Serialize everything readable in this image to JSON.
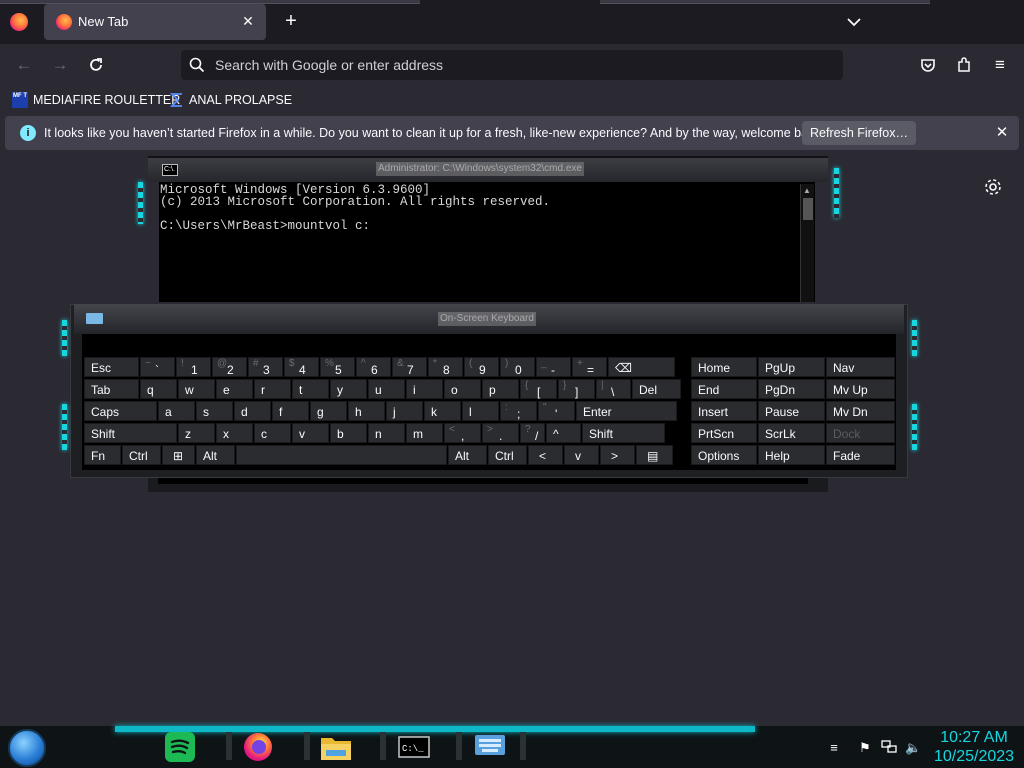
{
  "browser": {
    "tab_title": "New Tab",
    "url_placeholder": "Search with Google or enter address",
    "bookmarks": [
      {
        "label": "MEDIAFIRE ROULETTER",
        "icon_text": "MF T"
      },
      {
        "label": "ANAL PROLAPSE"
      }
    ],
    "notification": {
      "text": "It looks like you haven’t started Firefox in a while. Do you want to clean it up for a fresh, like-new experience? And by the way, welcome back!",
      "button": "Refresh Firefox…",
      "info_glyph": "i"
    },
    "accent_colors": {
      "chrome_bg": "#2b2a33",
      "tabstrip_bg": "#1c1b22",
      "notif_bg": "#42414d"
    }
  },
  "cmd": {
    "title": "Administrator: C:\\Windows\\system32\\cmd.exe",
    "icon_text": "C:\\.",
    "lines": [
      "Microsoft Windows [Version 6.3.9600]",
      "(c) 2013 Microsoft Corporation. All rights reserved.",
      "",
      "C:\\Users\\MrBeast>mountvol c:"
    ]
  },
  "osk": {
    "title": "On-Screen Keyboard",
    "rows": [
      [
        {
          "l": "Esc",
          "w": 56
        },
        {
          "s": "~",
          "m": "`",
          "w": 36
        },
        {
          "s": "!",
          "m": "1",
          "w": 36
        },
        {
          "s": "@",
          "m": "2",
          "w": 36
        },
        {
          "s": "#",
          "m": "3",
          "w": 36
        },
        {
          "s": "$",
          "m": "4",
          "w": 36
        },
        {
          "s": "%",
          "m": "5",
          "w": 36
        },
        {
          "s": "^",
          "m": "6",
          "w": 36
        },
        {
          "s": "&",
          "m": "7",
          "w": 36
        },
        {
          "s": "*",
          "m": "8",
          "w": 36
        },
        {
          "s": "(",
          "m": "9",
          "w": 36
        },
        {
          "s": ")",
          "m": "0",
          "w": 36
        },
        {
          "s": "_",
          "m": "-",
          "w": 36
        },
        {
          "s": "+",
          "m": "=",
          "w": 36
        },
        {
          "l": "⌫",
          "w": 68
        }
      ],
      [
        {
          "l": "Tab",
          "w": 56
        },
        {
          "l": "q",
          "w": 38
        },
        {
          "l": "w",
          "w": 38
        },
        {
          "l": "e",
          "w": 38
        },
        {
          "l": "r",
          "w": 38
        },
        {
          "l": "t",
          "w": 38
        },
        {
          "l": "y",
          "w": 38
        },
        {
          "l": "u",
          "w": 38
        },
        {
          "l": "i",
          "w": 38
        },
        {
          "l": "o",
          "w": 38
        },
        {
          "l": "p",
          "w": 38
        },
        {
          "s": "{",
          "m": "[",
          "w": 38
        },
        {
          "s": "}",
          "m": "]",
          "w": 38
        },
        {
          "s": "|",
          "m": "\\",
          "w": 36
        },
        {
          "l": "Del",
          "w": 50
        }
      ],
      [
        {
          "l": "Caps",
          "w": 74
        },
        {
          "l": "a",
          "w": 38
        },
        {
          "l": "s",
          "w": 38
        },
        {
          "l": "d",
          "w": 38
        },
        {
          "l": "f",
          "w": 38
        },
        {
          "l": "g",
          "w": 38
        },
        {
          "l": "h",
          "w": 38
        },
        {
          "l": "j",
          "w": 38
        },
        {
          "l": "k",
          "w": 38
        },
        {
          "l": "l",
          "w": 38
        },
        {
          "s": ":",
          "m": ";",
          "w": 38
        },
        {
          "s": "\"",
          "m": "'",
          "w": 38
        },
        {
          "l": "Enter",
          "w": 102
        }
      ],
      [
        {
          "l": "Shift",
          "w": 94
        },
        {
          "l": "z",
          "w": 38
        },
        {
          "l": "x",
          "w": 38
        },
        {
          "l": "c",
          "w": 38
        },
        {
          "l": "v",
          "w": 38
        },
        {
          "l": "b",
          "w": 38
        },
        {
          "l": "n",
          "w": 38
        },
        {
          "l": "m",
          "w": 38
        },
        {
          "s": "<",
          "m": ",",
          "w": 38
        },
        {
          "s": ">",
          "m": ".",
          "w": 38
        },
        {
          "s": "?",
          "m": "/",
          "w": 26
        },
        {
          "l": "^",
          "w": 36
        },
        {
          "l": "Shift",
          "w": 84
        }
      ],
      [
        {
          "l": "Fn",
          "w": 38
        },
        {
          "l": "Ctrl",
          "w": 40
        },
        {
          "l": "⊞",
          "w": 34
        },
        {
          "l": "Alt",
          "w": 40
        },
        {
          "l": "",
          "w": 212
        },
        {
          "l": "Alt",
          "w": 40
        },
        {
          "l": "Ctrl",
          "w": 40
        },
        {
          "l": "<",
          "w": 36
        },
        {
          "l": "v",
          "w": 36
        },
        {
          "l": ">",
          "w": 36
        },
        {
          "l": "▤",
          "w": 38
        }
      ]
    ],
    "nav_rows": [
      [
        "Home",
        "PgUp",
        "Nav"
      ],
      [
        "End",
        "PgDn",
        "Mv Up"
      ],
      [
        "Insert",
        "Pause",
        "Mv Dn"
      ],
      [
        "PrtScn",
        "ScrLk",
        "Dock"
      ],
      [
        "Options",
        "Help",
        "Fade"
      ]
    ],
    "dim_keys": [
      "Dock"
    ]
  },
  "taskbar": {
    "apps": [
      "spotify-icon",
      "firefox-icon",
      "file-explorer-icon",
      "cmd-icon",
      "osk-icon"
    ],
    "clock_time": "10:27 AM",
    "clock_date": "10/25/2023",
    "tray": [
      "flag-icon",
      "network-icon",
      "volume-icon"
    ],
    "accent": "#17d6e0"
  }
}
